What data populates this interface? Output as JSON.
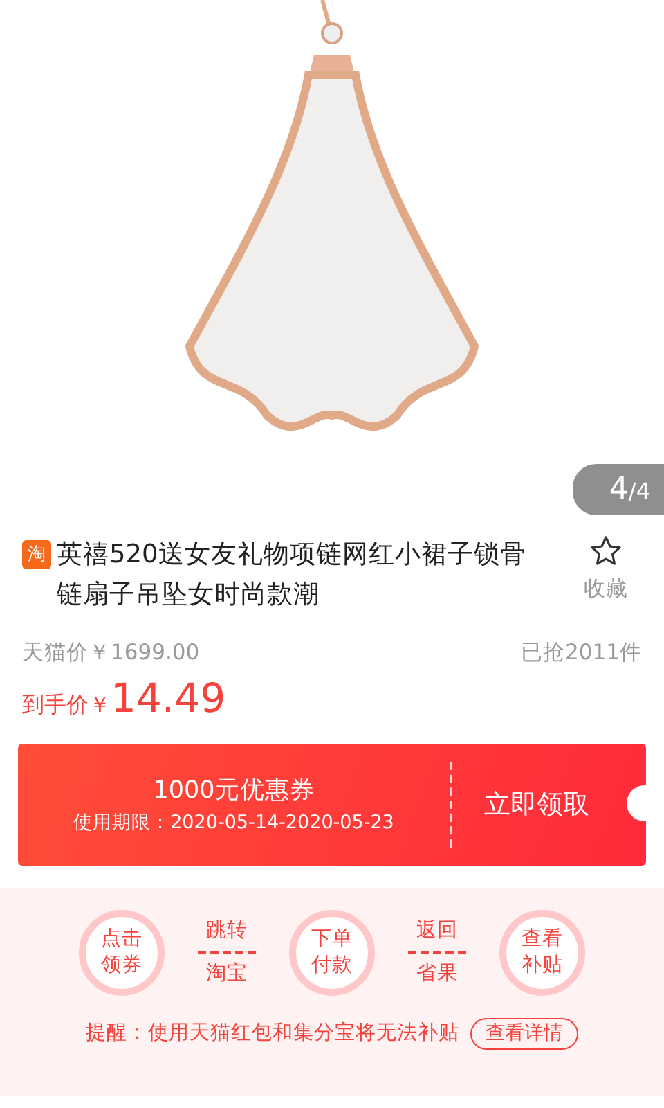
{
  "gallery": {
    "current": "4",
    "total": "/4"
  },
  "product": {
    "platform_icon": "淘",
    "title": "英禧520送女友礼物项链网红小裙子锁骨链扇子吊坠女时尚款潮",
    "favorite_label": "收藏",
    "original_price": "天猫价￥1699.00",
    "sold": "已抢2011件",
    "final_label": "到手价￥",
    "final_price": "14.49"
  },
  "coupon": {
    "title": "1000元优惠券",
    "validity": "使用期限：2020-05-14-2020-05-23",
    "action": "立即领取"
  },
  "steps": [
    {
      "kind": "circle",
      "top": "点击",
      "bottom": "领券"
    },
    {
      "kind": "divided",
      "top": "跳转",
      "bottom": "淘宝"
    },
    {
      "kind": "circle",
      "top": "下单",
      "bottom": "付款"
    },
    {
      "kind": "divided",
      "top": "返回",
      "bottom": "省果"
    },
    {
      "kind": "circle",
      "top": "查看",
      "bottom": "补贴"
    }
  ],
  "reminder": {
    "text": "提醒：使用天猫红包和集分宝将无法补贴",
    "link": "查看详情"
  }
}
